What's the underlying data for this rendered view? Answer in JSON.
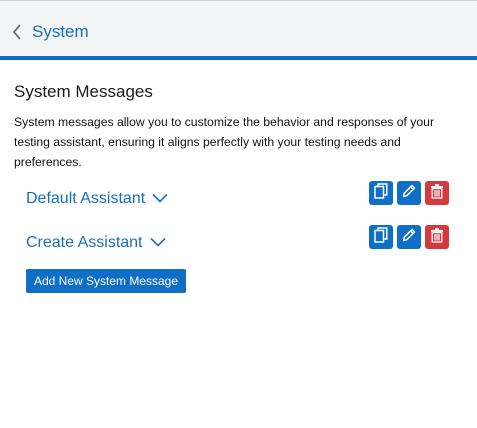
{
  "header": {
    "title": "System",
    "back_icon": "chevron-left-icon",
    "accent_color": "#0f6fc6"
  },
  "section": {
    "title": "System Messages",
    "description": "System messages allow you to customize the behavior and responses of your testing assistant, ensuring it aligns perfectly with your testing needs and preferences."
  },
  "messages": [
    {
      "name": "Default Assistant",
      "expand_icon": "chevron-down-icon"
    },
    {
      "name": "Create Assistant",
      "expand_icon": "chevron-down-icon"
    }
  ],
  "actions": {
    "copy_icon": "copy-icon",
    "edit_icon": "pencil-icon",
    "delete_icon": "trash-icon",
    "primary_color": "#0f6fc6",
    "danger_color": "#d23a3f"
  },
  "add_button": {
    "label": "Add New System Message"
  }
}
